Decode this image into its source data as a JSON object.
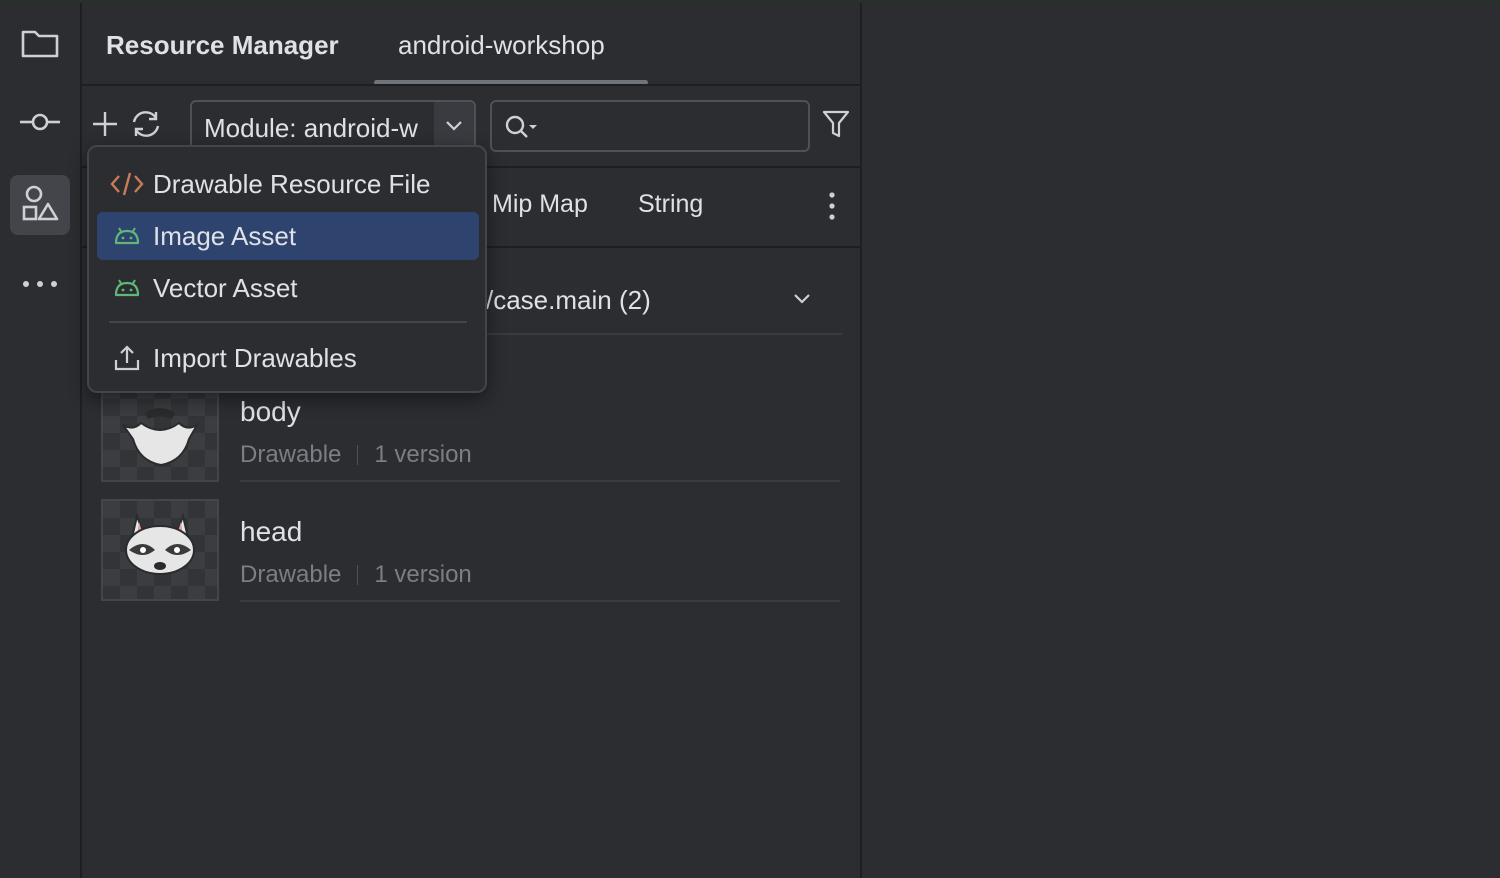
{
  "panel": {
    "title": "Resource Manager",
    "active_tab": "android-workshop"
  },
  "toolbar": {
    "module_select_value": "Module: android-w",
    "search_placeholder": ""
  },
  "category_tabs": [
    "Mip Map",
    "String"
  ],
  "source_group": {
    "label": "/case.main (2)"
  },
  "resources": [
    {
      "name": "body",
      "type": "Drawable",
      "versions": "1 version"
    },
    {
      "name": "head",
      "type": "Drawable",
      "versions": "1 version"
    }
  ],
  "add_menu": {
    "items": [
      {
        "label": "Drawable Resource File",
        "icon": "code-file-icon"
      },
      {
        "label": "Image Asset",
        "icon": "android-icon"
      },
      {
        "label": "Vector Asset",
        "icon": "android-icon"
      }
    ],
    "import_label": "Import Drawables",
    "selected_index": 1
  },
  "colors": {
    "background": "#2b2d30",
    "selection": "#2e436e",
    "android_green": "#5fb878",
    "code_orange": "#c77d55"
  }
}
